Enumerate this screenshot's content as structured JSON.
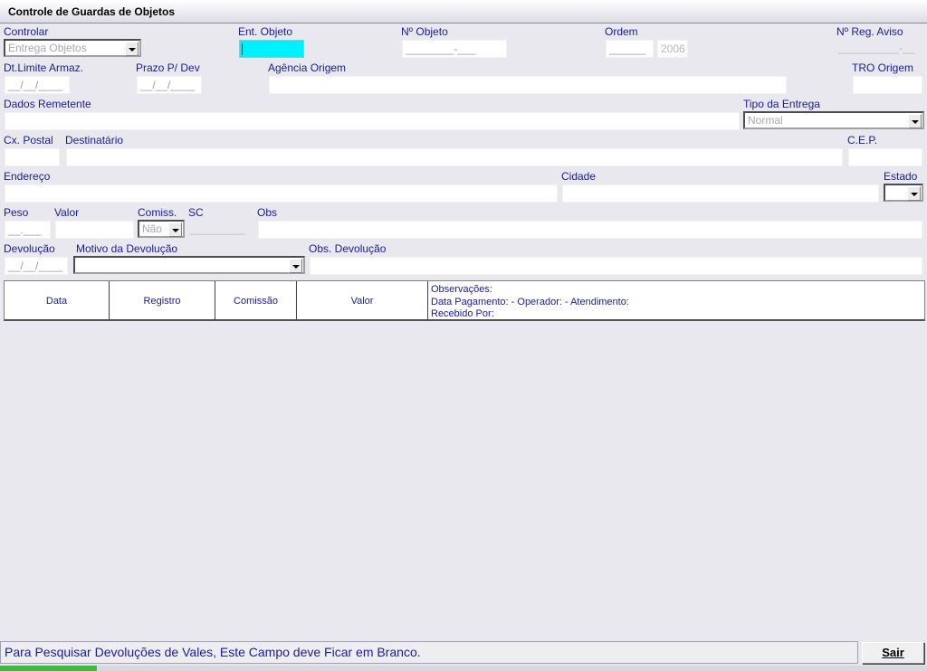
{
  "window": {
    "title": "Controle de Guardas de Objetos"
  },
  "form": {
    "controlar": {
      "label": "Controlar",
      "value": "Entrega Objetos"
    },
    "ent_objeto": {
      "label": "Ent. Objeto",
      "value": ""
    },
    "num_objeto": {
      "label": "Nº Objeto",
      "value": "________-___"
    },
    "ordem": {
      "label": "Ordem",
      "value": "______",
      "year": "2006"
    },
    "num_reg_aviso": {
      "label": "Nº Reg. Aviso",
      "value": "__________-__"
    },
    "dt_limite": {
      "label": "Dt.Limite Armaz.",
      "value": "__/__/____"
    },
    "prazo_dev": {
      "label": "Prazo P/ Dev",
      "value": "__/__/____"
    },
    "agencia_origem": {
      "label": "Agência Origem",
      "value": ""
    },
    "tro_origem": {
      "label": "TRO Origem",
      "value": ""
    },
    "dados_remetente": {
      "label": "Dados Remetente",
      "value": ""
    },
    "tipo_entrega": {
      "label": "Tipo da Entrega",
      "value": "Normal"
    },
    "cx_postal": {
      "label": "Cx. Postal",
      "value": ""
    },
    "destinatario": {
      "label": "Destinatário",
      "value": ""
    },
    "cep": {
      "label": "C.E.P.",
      "value": ""
    },
    "endereco": {
      "label": "Endereço",
      "value": ""
    },
    "cidade": {
      "label": "Cidade",
      "value": ""
    },
    "estado": {
      "label": "Estado",
      "value": ""
    },
    "peso": {
      "label": "Peso",
      "value": "__.___"
    },
    "valor": {
      "label": "Valor",
      "value": ""
    },
    "comiss": {
      "label": "Comiss.",
      "value": "Não"
    },
    "sc": {
      "label": "SC",
      "value": "_________"
    },
    "obs": {
      "label": "Obs",
      "value": ""
    },
    "devolucao": {
      "label": "Devolução",
      "value": "__/__/____"
    },
    "motivo_devolucao": {
      "label": "Motivo da Devolução",
      "value": ""
    },
    "obs_devolucao": {
      "label": "Obs. Devolução",
      "value": ""
    }
  },
  "grid": {
    "columns": [
      "Data",
      "Registro",
      "Comissão",
      "Valor"
    ],
    "observacoes_label": "Observações:",
    "pagamento_line": "Data Pagamento:  -  Operador:  -  Atendimento:",
    "recebido_label": "Recebido Por:"
  },
  "status_bar": {
    "message": "Para Pesquisar Devoluções de Vales, Este Campo deve Ficar em Branco."
  },
  "buttons": {
    "sair": "Sair"
  },
  "colors": {
    "label": "#1a1aa0",
    "active_field": "#00f0ff",
    "background": "#e8e8ee"
  }
}
